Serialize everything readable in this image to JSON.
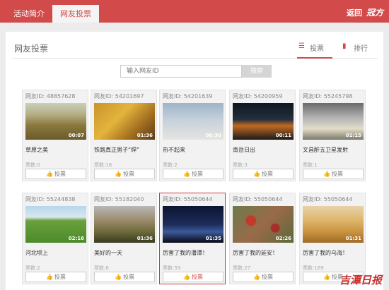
{
  "header": {
    "tabs": [
      {
        "label": "活动简介"
      },
      {
        "label": "网友投票"
      }
    ],
    "back_label": "返回",
    "logo_text": "冠方",
    "accent": "#d24a4a"
  },
  "panel": {
    "title": "网友投票",
    "view_tabs": [
      {
        "label": "投票",
        "icon": "list-icon"
      },
      {
        "label": "排行",
        "icon": "bar-chart-icon"
      }
    ]
  },
  "search": {
    "placeholder": "输入网友ID",
    "button_label": "搜索"
  },
  "cards": [
    {
      "id_label": "网友ID: 48857628",
      "duration": "00:07",
      "title": "草原之美",
      "votes": "票数:0",
      "vote_label": "投票"
    },
    {
      "id_label": "网友ID: 54201697",
      "duration": "01:36",
      "title": "铁路真正男子“焊”",
      "votes": "票数:18",
      "vote_label": "投票"
    },
    {
      "id_label": "网友ID: 54201639",
      "duration": "00:30",
      "title": "热不起来",
      "votes": "票数:2",
      "vote_label": "投票"
    },
    {
      "id_label": "网友ID: 54200959",
      "duration": "00:11",
      "title": "南岳日出",
      "votes": "票数:3",
      "vote_label": "投票"
    },
    {
      "id_label": "网友ID: 55245798",
      "duration": "01:15",
      "title": "文昌酐五卫星发射",
      "votes": "票数:1",
      "vote_label": "投票"
    },
    {
      "id_label": "网友ID: 55244838",
      "duration": "02:16",
      "title": "河北坝上",
      "votes": "票数:2",
      "vote_label": "投票"
    },
    {
      "id_label": "网友ID: 55182040",
      "duration": "01:36",
      "title": "美好的一天",
      "votes": "票数:6",
      "vote_label": "投票"
    },
    {
      "id_label": "网友ID: 55050644",
      "duration": "01:35",
      "title": "厉害了我的潘潭！",
      "votes": "票数:59",
      "vote_label": "投票"
    },
    {
      "id_label": "网友ID: 55050644",
      "duration": "02:26",
      "title": "厉害了我的延安！",
      "votes": "票数:27",
      "vote_label": "投票"
    },
    {
      "id_label": "网友ID: 55050644",
      "duration": "01:31",
      "title": "厉害了我的乌海！",
      "votes": "票数:169",
      "vote_label": "投票"
    }
  ],
  "watermark": "吉潭日报"
}
